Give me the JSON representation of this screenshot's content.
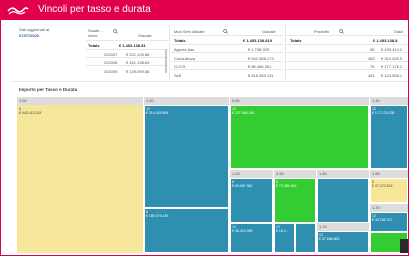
{
  "app": {
    "title": "Vincoli per tasso e durata"
  },
  "updated": {
    "label": "Dati aggiornati al:",
    "date": "07/07/2020"
  },
  "table1": {
    "headers": [
      "Scade...",
      "Anno",
      "Giacale"
    ],
    "totals_label": "Totals",
    "totals_value": "€ 1.453.138.81",
    "rows": [
      {
        "code": "202007",
        "value": "€ 221.105.86"
      },
      {
        "code": "202008",
        "value": "€ 161.138.89"
      },
      {
        "code": "202009",
        "value": "€ 139.059.88"
      }
    ]
  },
  "table2": {
    "headers": [
      "Mod Serv Attuale",
      "Giacale"
    ],
    "totals_label": "Totals",
    "totals_value": "€ 1.453.138.819",
    "rows": [
      {
        "name": "Agente Ass",
        "value": "€ 1.738.339"
      },
      {
        "name": "Consulenza",
        "value": "€ 542.588.173"
      },
      {
        "name": "G.O.R.",
        "value": "€ 86.466.361"
      },
      {
        "name": "Self",
        "value": "€ 818.359.131"
      }
    ]
  },
  "table3": {
    "headers": [
      "Prodotto",
      "Giaci"
    ],
    "totals_label": "Totals",
    "totals_value": "€ 1.453.138.8",
    "rows": [
      {
        "code": "98",
        "value": "€ 433.413.2"
      },
      {
        "code": "483",
        "value": "€ 314.426.5"
      },
      {
        "code": "79",
        "value": "€ 177.176.2"
      },
      {
        "code": "481",
        "value": "€ 123.065.1"
      }
    ]
  },
  "treemap": {
    "title": "Importo per Tasso e Durata",
    "groups": [
      "1.50",
      "1.20",
      "0.80",
      "1.40",
      "1.00",
      "0.50",
      "1.80",
      "1.30",
      "1.10"
    ],
    "tiles": [
      {
        "code": "6",
        "value": "€ 443.413.219",
        "color": "#f6e69a"
      },
      {
        "code": "12",
        "value": "€ 314.426.584",
        "color": "#2e8fb0"
      },
      {
        "code": "12",
        "value": "€ 137.486.245",
        "color": "#33cc33"
      },
      {
        "code": "12",
        "value": "€ 177.176.238",
        "color": "#2e8fb0"
      },
      {
        "code": "6",
        "value": "€ 189.076.149",
        "color": "#2e8fb0"
      },
      {
        "code": "6",
        "value": "€ 63.487.382",
        "color": "#2e8fb0"
      },
      {
        "code": "6",
        "value": "€ 72.385.816",
        "color": "#33cc33"
      },
      {
        "code": "6",
        "value": "€ 37.272.818",
        "color": "#f6e69a"
      },
      {
        "code": "12",
        "value": "€ 38.415.398",
        "color": "#2e8fb0"
      },
      {
        "code": "12",
        "value": "€ 16.4...",
        "color": "#2e8fb0"
      },
      {
        "code": "12",
        "value": "€ 33.765.767",
        "color": "#2e8fb0"
      },
      {
        "code": "12",
        "value": "€ 37.566.863",
        "color": "#33cc33"
      }
    ]
  },
  "colors": {
    "accent": "#e0004d",
    "blue": "#2e8fb0",
    "green": "#33cc33",
    "yellow": "#f6e69a",
    "link": "#1f5f9f"
  }
}
